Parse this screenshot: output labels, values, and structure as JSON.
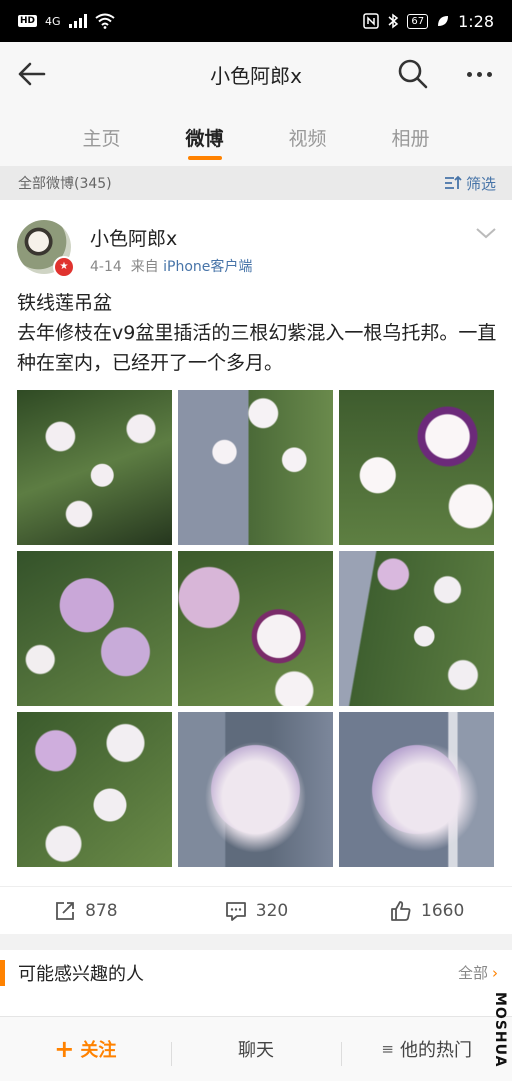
{
  "status_bar": {
    "hd": "HD",
    "network": "4G",
    "battery": "67",
    "time": "1:28"
  },
  "header": {
    "title": "小色阿郎x"
  },
  "tabs": [
    "主页",
    "微博",
    "视频",
    "相册"
  ],
  "filter": {
    "count_label": "全部微博(345)",
    "filter_label": "筛选"
  },
  "post": {
    "author": "小色阿郎x",
    "date": "4-14",
    "from": "来自",
    "source": "iPhone客户端",
    "text": "铁线莲吊盆\n去年修枝在v9盆里插活的三根幻紫混入一根乌托邦。一直种在室内，已经开了一个多月。",
    "photos": [
      "clematis-1",
      "clematis-2",
      "clematis-3",
      "clematis-4",
      "clematis-5",
      "clematis-6",
      "clematis-7",
      "clematis-8",
      "clematis-9"
    ],
    "reposts": "878",
    "comments": "320",
    "likes": "1660"
  },
  "recommendations": {
    "title": "可能感兴趣的人",
    "all_label": "全部"
  },
  "bottom_bar": {
    "follow": "关注",
    "chat": "聊天",
    "hot": "他的热门"
  },
  "watermark": "MOSHUA",
  "colors": {
    "accent": "#ff8200",
    "link": "#4774a8"
  }
}
